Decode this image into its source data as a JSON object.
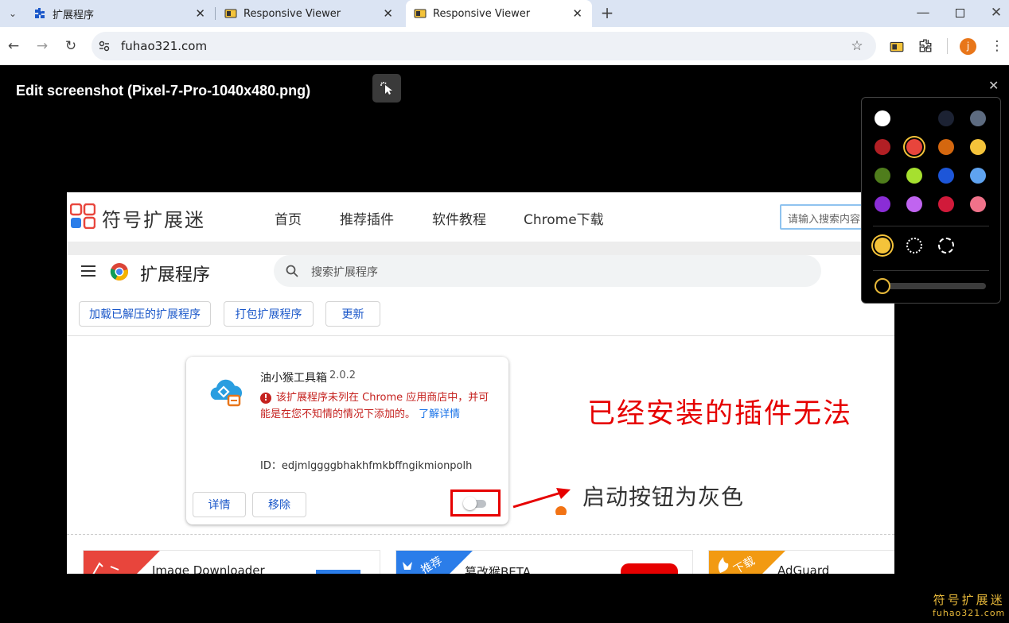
{
  "browser": {
    "tabs": [
      {
        "title": "扩展程序",
        "active": false
      },
      {
        "title": "Responsive Viewer",
        "active": false
      },
      {
        "title": "Responsive Viewer",
        "active": true
      }
    ],
    "url": "fuhao321.com",
    "profile_initial": "j"
  },
  "editor": {
    "title": "Edit screenshot (Pixel-7-Pro-1040x480.png)",
    "palette": {
      "colors": [
        "#ffffff",
        "#000000",
        "#1c2233",
        "#5d6b80",
        "#b21f24",
        "#e8453c",
        "#d4670f",
        "#f4c33a",
        "#4f7d1c",
        "#a6e02f",
        "#1d56d8",
        "#5fa3f0",
        "#8a2dd6",
        "#c064f0",
        "#d11a3a",
        "#f0728a"
      ],
      "selected_color": "#e8453c",
      "brush_styles": [
        "solid",
        "dotted",
        "dashed"
      ],
      "selected_brush": "solid",
      "size_level": 0
    }
  },
  "screenshot": {
    "site": {
      "name": "符号扩展迷",
      "nav": [
        "首页",
        "推荐插件",
        "软件教程",
        "Chrome下载"
      ],
      "search_placeholder": "请输入搜索内容"
    },
    "extensions_page": {
      "title": "扩展程序",
      "search_placeholder": "搜索扩展程序",
      "buttons": [
        "加载已解压的扩展程序",
        "打包扩展程序",
        "更新"
      ]
    },
    "card": {
      "name": "油小猴工具箱",
      "version": "2.0.2",
      "warning": "该扩展程序未列在 Chrome 应用商店中，并可能是在您不知情的情况下添加的。",
      "learn_more": "了解详情",
      "id_label": "ID：",
      "id_value": "edjmlggggbhakhfmkbffngikmionpolh",
      "details_button": "详情",
      "remove_button": "移除",
      "enabled": false
    },
    "annotation_heading": "已经安装的插件无法",
    "annotation_hint": "启动按钮为灰色",
    "recommended": [
      {
        "ribbon": "",
        "name": "Image Downloader"
      },
      {
        "ribbon": "推荐",
        "name": "篡改猴BETA"
      },
      {
        "ribbon": "下载",
        "name": "AdGuard"
      }
    ]
  },
  "watermark": {
    "name": "符号扩展迷",
    "url": "fuhao321.com"
  }
}
